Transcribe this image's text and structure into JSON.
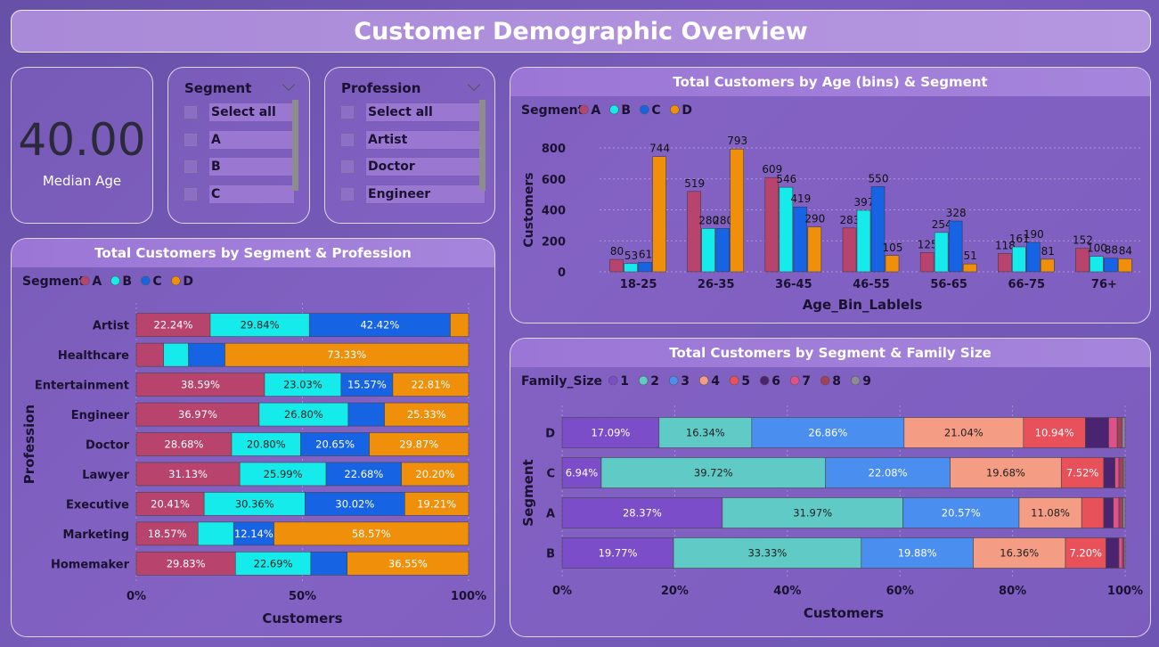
{
  "page": {
    "title": "Customer Demographic Overview"
  },
  "kpi": {
    "value": "40.00",
    "label": "Median Age"
  },
  "segment_slicer": {
    "title": "Segment",
    "items": [
      "Select all",
      "A",
      "B",
      "C"
    ]
  },
  "profession_slicer": {
    "title": "Profession",
    "items": [
      "Select all",
      "Artist",
      "Doctor",
      "Engineer"
    ]
  },
  "colors": {
    "segA": "#b8446e",
    "segB": "#14ebea",
    "segC": "#1664e4",
    "segD": "#f0900a",
    "fam1": "#7b4dc8",
    "fam2": "#5fcac6",
    "fam3": "#4a8ef0",
    "fam4": "#f49c84",
    "fam5": "#e8505a",
    "fam6": "#4a2470",
    "fam7": "#e0508a",
    "fam8": "#a0405a",
    "fam9": "#8a8a9a"
  },
  "chart_data": [
    {
      "id": "age",
      "type": "bar",
      "title": "Total Customers by Age (bins) & Segment",
      "xlabel": "Age_Bin_Lablels",
      "ylabel": "Customers",
      "legend_title": "Segment",
      "legend_position": "top-left",
      "categories": [
        "18-25",
        "26-35",
        "36-45",
        "46-55",
        "56-65",
        "66-75",
        "76+"
      ],
      "series": [
        {
          "name": "A",
          "values": [
            80,
            519,
            609,
            283,
            125,
            118,
            152
          ]
        },
        {
          "name": "B",
          "values": [
            53,
            280,
            546,
            397,
            254,
            161,
            100
          ]
        },
        {
          "name": "C",
          "values": [
            61,
            280,
            419,
            550,
            328,
            190,
            88
          ]
        },
        {
          "name": "D",
          "values": [
            744,
            793,
            290,
            105,
            51,
            81,
            84
          ]
        }
      ],
      "ylim": [
        0,
        800
      ],
      "yticks": [
        0,
        200,
        400,
        600,
        800
      ],
      "grid": true
    },
    {
      "id": "profession",
      "type": "bar",
      "orientation": "horizontal-stacked-100",
      "title": "Total Customers by Segment & Profession",
      "xlabel": "Customers",
      "ylabel": "Profession",
      "legend_title": "Segment",
      "legend_position": "top-left",
      "categories": [
        "Artist",
        "Healthcare",
        "Entertainment",
        "Engineer",
        "Doctor",
        "Lawyer",
        "Executive",
        "Marketing",
        "Homemaker"
      ],
      "series": [
        {
          "name": "A",
          "values": [
            22.24,
            8.2,
            38.59,
            36.97,
            28.68,
            31.13,
            20.41,
            18.57,
            29.83
          ]
        },
        {
          "name": "B",
          "values": [
            29.84,
            7.5,
            23.03,
            26.8,
            20.8,
            25.99,
            30.36,
            10.72,
            22.69
          ]
        },
        {
          "name": "C",
          "values": [
            42.42,
            10.97,
            15.57,
            10.9,
            20.65,
            22.68,
            30.02,
            12.14,
            10.93
          ]
        },
        {
          "name": "D",
          "values": [
            5.5,
            73.33,
            22.81,
            25.33,
            29.87,
            20.2,
            19.21,
            58.57,
            36.55
          ]
        }
      ],
      "labels": [
        [
          "22.24%",
          "29.84%",
          "42.42%",
          ""
        ],
        [
          "",
          "",
          "",
          "73.33%"
        ],
        [
          "38.59%",
          "23.03%",
          "15.57%",
          "22.81%"
        ],
        [
          "36.97%",
          "26.80%",
          "",
          "25.33%"
        ],
        [
          "28.68%",
          "20.80%",
          "20.65%",
          "29.87%"
        ],
        [
          "31.13%",
          "25.99%",
          "22.68%",
          "20.20%"
        ],
        [
          "20.41%",
          "30.36%",
          "30.02%",
          "19.21%"
        ],
        [
          "18.57%",
          "",
          "12.14%",
          "58.57%"
        ],
        [
          "29.83%",
          "22.69%",
          "",
          "36.55%"
        ]
      ],
      "xticks": [
        "0%",
        "50%",
        "100%"
      ]
    },
    {
      "id": "family",
      "type": "bar",
      "orientation": "horizontal-stacked-100",
      "title": "Total Customers by Segment & Family Size",
      "xlabel": "Customers",
      "ylabel": "Segment",
      "legend_title": "Family_Size",
      "legend_position": "top-left",
      "categories": [
        "D",
        "C",
        "A",
        "B"
      ],
      "series": [
        {
          "name": "1",
          "values": [
            17.09,
            6.94,
            28.37,
            19.77
          ]
        },
        {
          "name": "2",
          "values": [
            16.34,
            39.72,
            31.97,
            33.33
          ]
        },
        {
          "name": "3",
          "values": [
            26.86,
            22.08,
            20.57,
            19.88
          ]
        },
        {
          "name": "4",
          "values": [
            21.04,
            19.68,
            11.08,
            16.36
          ]
        },
        {
          "name": "5",
          "values": [
            10.94,
            7.52,
            3.9,
            7.2
          ]
        },
        {
          "name": "6",
          "values": [
            4.1,
            2.0,
            1.7,
            2.3
          ]
        },
        {
          "name": "7",
          "values": [
            1.5,
            0.7,
            1.0,
            0.6
          ]
        },
        {
          "name": "8",
          "values": [
            0.9,
            0.8,
            0.7,
            0.3
          ]
        },
        {
          "name": "9",
          "values": [
            0.5,
            0.3,
            0.4,
            0.2
          ]
        }
      ],
      "labels": [
        [
          "17.09%",
          "16.34%",
          "26.86%",
          "21.04%",
          "10.94%",
          "",
          "",
          "",
          ""
        ],
        [
          "6.94%",
          "39.72%",
          "22.08%",
          "19.68%",
          "7.52%",
          "",
          "",
          "",
          ""
        ],
        [
          "28.37%",
          "31.97%",
          "20.57%",
          "11.08%",
          "",
          "",
          "",
          "",
          ""
        ],
        [
          "19.77%",
          "33.33%",
          "19.88%",
          "16.36%",
          "7.20%",
          "",
          "",
          "",
          ""
        ]
      ],
      "xticks": [
        "0%",
        "20%",
        "40%",
        "60%",
        "80%",
        "100%"
      ]
    }
  ]
}
